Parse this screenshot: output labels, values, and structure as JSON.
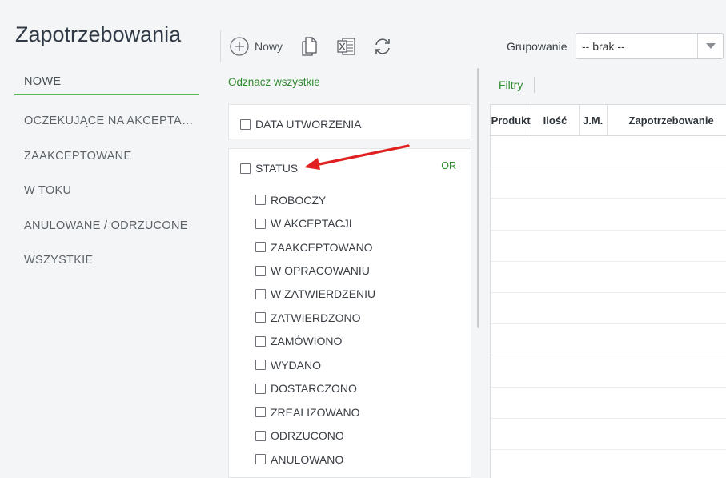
{
  "page": {
    "title": "Zapotrzebowania"
  },
  "nav": {
    "items": [
      {
        "label": "NOWE"
      },
      {
        "label": "OCZEKUJĄCE NA AKCEPTA…"
      },
      {
        "label": "ZAAKCEPTOWANE"
      },
      {
        "label": "W TOKU"
      },
      {
        "label": "ANULOWANE / ODRZUCONE"
      },
      {
        "label": "WSZYSTKIE"
      }
    ],
    "active_index": 0
  },
  "toolbar": {
    "new_label": "Nowy",
    "icons": [
      "plus-circle-icon",
      "copy-document-icon",
      "excel-export-icon",
      "refresh-icon"
    ]
  },
  "grouping": {
    "label": "Grupowanie",
    "value": "-- brak --"
  },
  "filters": {
    "uncheck_all": "Odznacz wszystkie",
    "date_label": "DATA UTWORZENIA",
    "status_label": "STATUS",
    "status_operator": "OR",
    "status_options": [
      "ROBOCZY",
      "W AKCEPTACJI",
      "ZAAKCEPTOWANO",
      "W OPRACOWANIU",
      "W ZATWIERDZENIU",
      "ZATWIERDZONO",
      "ZAMÓWIONO",
      "WYDANO",
      "DOSTARCZONO",
      "ZREALIZOWANO",
      "ODRZUCONO",
      "ANULOWANO"
    ]
  },
  "grid": {
    "filters_label": "Filtry",
    "columns": [
      "Produkt",
      "Ilość",
      "J.M.",
      "Zapotrzebowanie"
    ]
  },
  "colors": {
    "accent_green": "#2e8b2e",
    "active_underline": "#5cb85c",
    "annotation_arrow": "#e02020"
  }
}
